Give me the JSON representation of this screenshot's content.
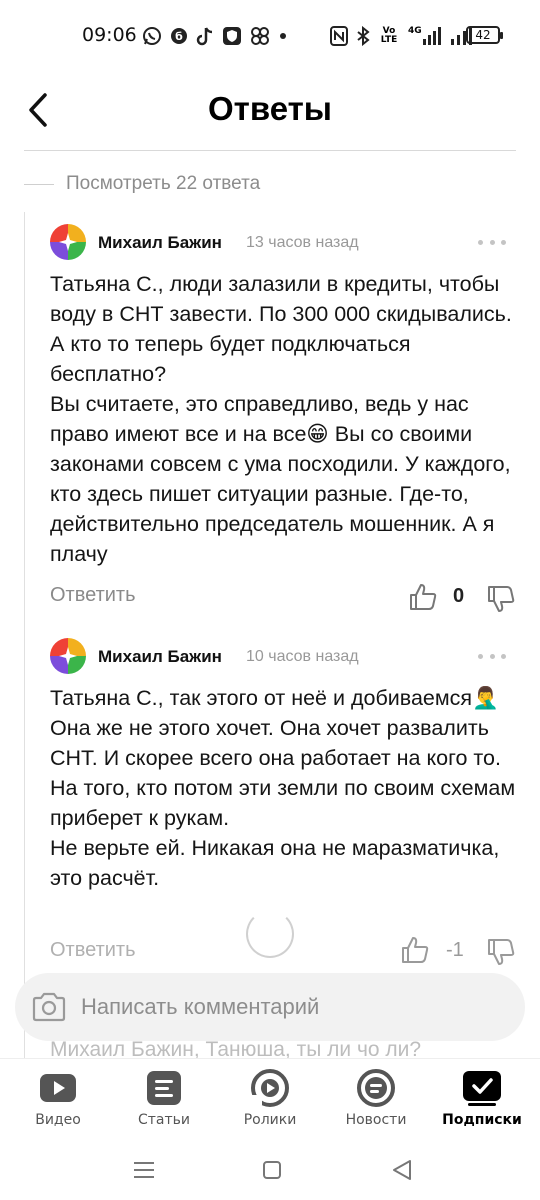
{
  "status_bar": {
    "time": "09:06",
    "battery": "42",
    "icons_left": [
      "whatsapp-icon",
      "b-badge-icon",
      "tiktok-icon",
      "shield-app-icon",
      "pinwheel-icon",
      "dot-icon"
    ],
    "icons_right": [
      "nfc-icon",
      "bluetooth-icon",
      "volte-icon",
      "signal-4g-icon",
      "signal-icon",
      "battery-icon"
    ],
    "volte_label": "Vo LTE",
    "net_label": "4G"
  },
  "header": {
    "title": "Ответы",
    "back_icon": "chevron-left-icon"
  },
  "view_replies": "Посмотреть 22 ответа",
  "comments": [
    {
      "author": "Михаил Бажин",
      "time": "13 часов назад",
      "text": "Татьяна С., люди залазили в кредиты, чтобы воду в СНТ завести. По 300 000 скидывались. А кто то теперь будет подключаться бесплатно?\nВы считаете, это справедливо, ведь у нас право имеют все и на все😁 Вы со своими законами совсем с ума посходили. У каждого, кто здесь пишет ситуации разные. Где-то, действительно председатель мошенник. А я плачу",
      "reply_label": "Ответить",
      "votes": "0"
    },
    {
      "author": "Михаил Бажин",
      "time": "10 часов назад",
      "text": "Татьяна С., так этого от неё и добиваемся🤦‍♂️ Она же не этого хочет. Она хочет развалить СНТ. И скорее всего она работает на кого то. На того, кто потом эти земли по своим схемам приберет к рукам.\nНе верьте ей. Никакая она не маразматичка, это расчёт.",
      "reply_label": "Ответить",
      "votes": "-1"
    }
  ],
  "peek_text": "Михаил Бажин, Танюша, ты ли чо ли?",
  "comment_input": {
    "placeholder": "Написать комментарий"
  },
  "tabs": [
    {
      "label": "Видео",
      "icon": "video-play-icon",
      "active": false
    },
    {
      "label": "Статьи",
      "icon": "articles-icon",
      "active": false
    },
    {
      "label": "Ролики",
      "icon": "shorts-icon",
      "active": false
    },
    {
      "label": "Новости",
      "icon": "news-icon",
      "active": false
    },
    {
      "label": "Подписки",
      "icon": "subscriptions-check-icon",
      "active": true
    }
  ],
  "colors": {
    "text": "#151515",
    "muted": "#8a8a8a",
    "input_bg": "#f2f2f2",
    "tab_icon": "#555555",
    "active_tab": "#000000"
  }
}
